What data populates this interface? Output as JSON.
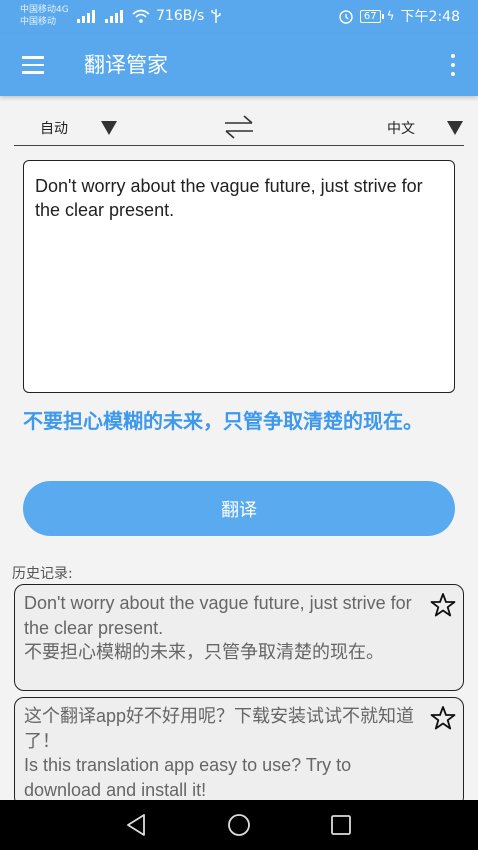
{
  "status_bar": {
    "carrier_1": "中国移动4G",
    "carrier_2": "中国移动",
    "network_speed": "716B/s",
    "battery": "67",
    "time": "下午2:48"
  },
  "app_bar": {
    "title": "翻译管家",
    "menu_icon": "hamburger-menu-icon",
    "more_icon": "more-vertical-icon"
  },
  "language_bar": {
    "source_language": "自动",
    "target_language": "中文",
    "swap_icon": "swap-arrows-icon"
  },
  "input": {
    "value": "Don't worry about the vague future, just strive for the clear present."
  },
  "result": {
    "text": "不要担心模糊的未来，只管争取清楚的现在。"
  },
  "translate_button": {
    "label": "翻译"
  },
  "history": {
    "label": "历史记录:",
    "items": [
      {
        "source": "Don't worry about the vague future, just strive for the clear present.",
        "translation": "不要担心模糊的未来，只管争取清楚的现在。"
      },
      {
        "source": "这个翻译app好不好用呢？下载安装试试不就知道了！",
        "translation": "Is this translation app easy to use? Try to download and install it!"
      }
    ]
  },
  "colors": {
    "primary": "#59a8ee",
    "result_text": "#3e99ec",
    "button": "#5aaaf0"
  }
}
